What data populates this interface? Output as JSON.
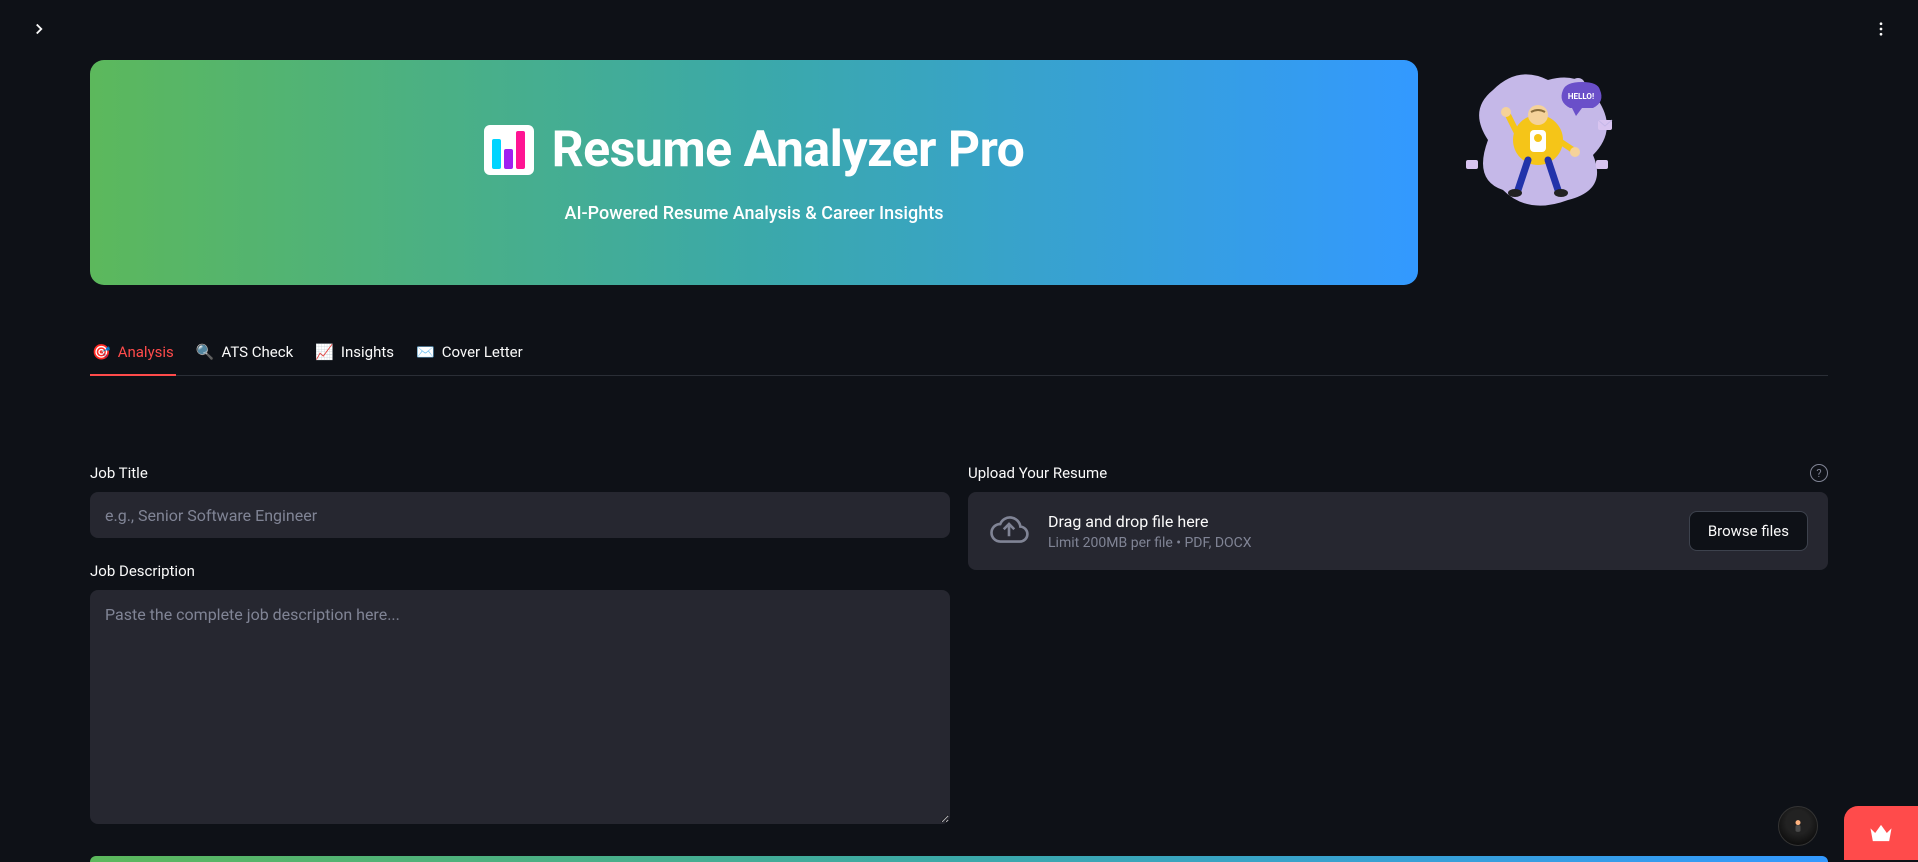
{
  "hero": {
    "title": "Resume Analyzer Pro",
    "subtitle": "AI-Powered Resume Analysis & Career Insights"
  },
  "mascot": {
    "bubble_text": "HELLO!"
  },
  "tabs": [
    {
      "emoji": "🎯",
      "label": "Analysis",
      "active": true
    },
    {
      "emoji": "🔍",
      "label": "ATS Check",
      "active": false
    },
    {
      "emoji": "📈",
      "label": "Insights",
      "active": false
    },
    {
      "emoji": "✉️",
      "label": "Cover Letter",
      "active": false
    }
  ],
  "fields": {
    "job_title": {
      "label": "Job Title",
      "placeholder": "e.g., Senior Software Engineer",
      "value": ""
    },
    "job_description": {
      "label": "Job Description",
      "placeholder": "Paste the complete job description here...",
      "value": ""
    },
    "upload": {
      "label": "Upload Your Resume",
      "drop_text": "Drag and drop file here",
      "limit_text": "Limit 200MB per file • PDF, DOCX",
      "browse_label": "Browse files"
    }
  }
}
